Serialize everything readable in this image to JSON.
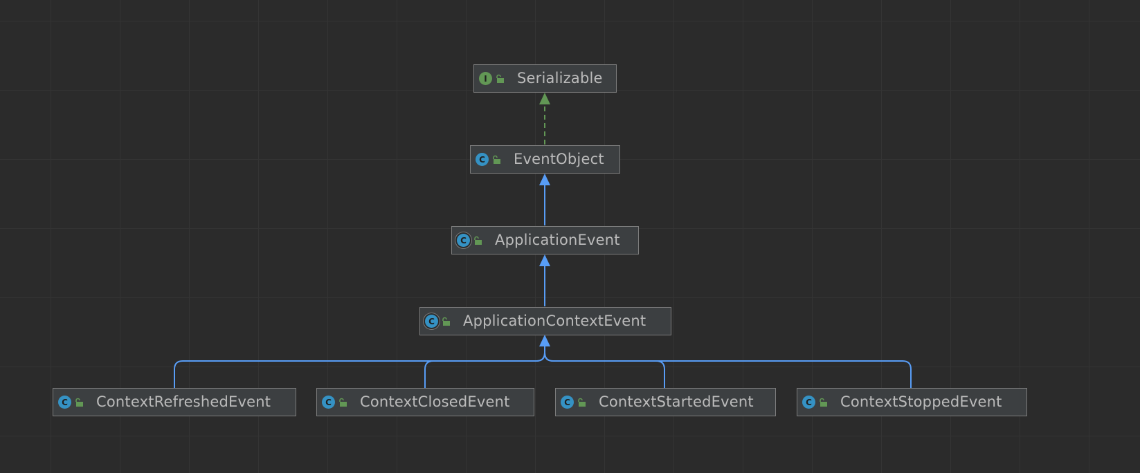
{
  "colors": {
    "background": "#2b2b2b",
    "node_fill": "#3c3f41",
    "node_border": "#7d7d7d",
    "text": "#bbbbbb",
    "extends_edge": "#589df6",
    "implements_edge": "#629755",
    "interface_badge": "#629755",
    "class_badge": "#3592c4"
  },
  "nodes": [
    {
      "id": "serializable",
      "name": "Serializable",
      "kind": "interface",
      "badge": "I",
      "visibility_icon": "unlocked-icon"
    },
    {
      "id": "eventobject",
      "name": "EventObject",
      "kind": "class",
      "badge": "C",
      "visibility_icon": "unlocked-icon"
    },
    {
      "id": "applicationevent",
      "name": "ApplicationEvent",
      "kind": "abstract-class",
      "badge": "C",
      "visibility_icon": "unlocked-icon"
    },
    {
      "id": "applicationcontextevent",
      "name": "ApplicationContextEvent",
      "kind": "abstract-class",
      "badge": "C",
      "visibility_icon": "unlocked-icon"
    },
    {
      "id": "contextrefreshedevent",
      "name": "ContextRefreshedEvent",
      "kind": "class",
      "badge": "C",
      "visibility_icon": "unlocked-icon"
    },
    {
      "id": "contextclosedevent",
      "name": "ContextClosedEvent",
      "kind": "class",
      "badge": "C",
      "visibility_icon": "unlocked-icon"
    },
    {
      "id": "contextstartedevent",
      "name": "ContextStartedEvent",
      "kind": "class",
      "badge": "C",
      "visibility_icon": "unlocked-icon"
    },
    {
      "id": "contextstoppedevent",
      "name": "ContextStoppedEvent",
      "kind": "class",
      "badge": "C",
      "visibility_icon": "unlocked-icon"
    }
  ],
  "edges": [
    {
      "from": "eventobject",
      "to": "serializable",
      "type": "implements"
    },
    {
      "from": "applicationevent",
      "to": "eventobject",
      "type": "extends"
    },
    {
      "from": "applicationcontextevent",
      "to": "applicationevent",
      "type": "extends"
    },
    {
      "from": "contextrefreshedevent",
      "to": "applicationcontextevent",
      "type": "extends"
    },
    {
      "from": "contextclosedevent",
      "to": "applicationcontextevent",
      "type": "extends"
    },
    {
      "from": "contextstartedevent",
      "to": "applicationcontextevent",
      "type": "extends"
    },
    {
      "from": "contextstoppedevent",
      "to": "applicationcontextevent",
      "type": "extends"
    }
  ]
}
